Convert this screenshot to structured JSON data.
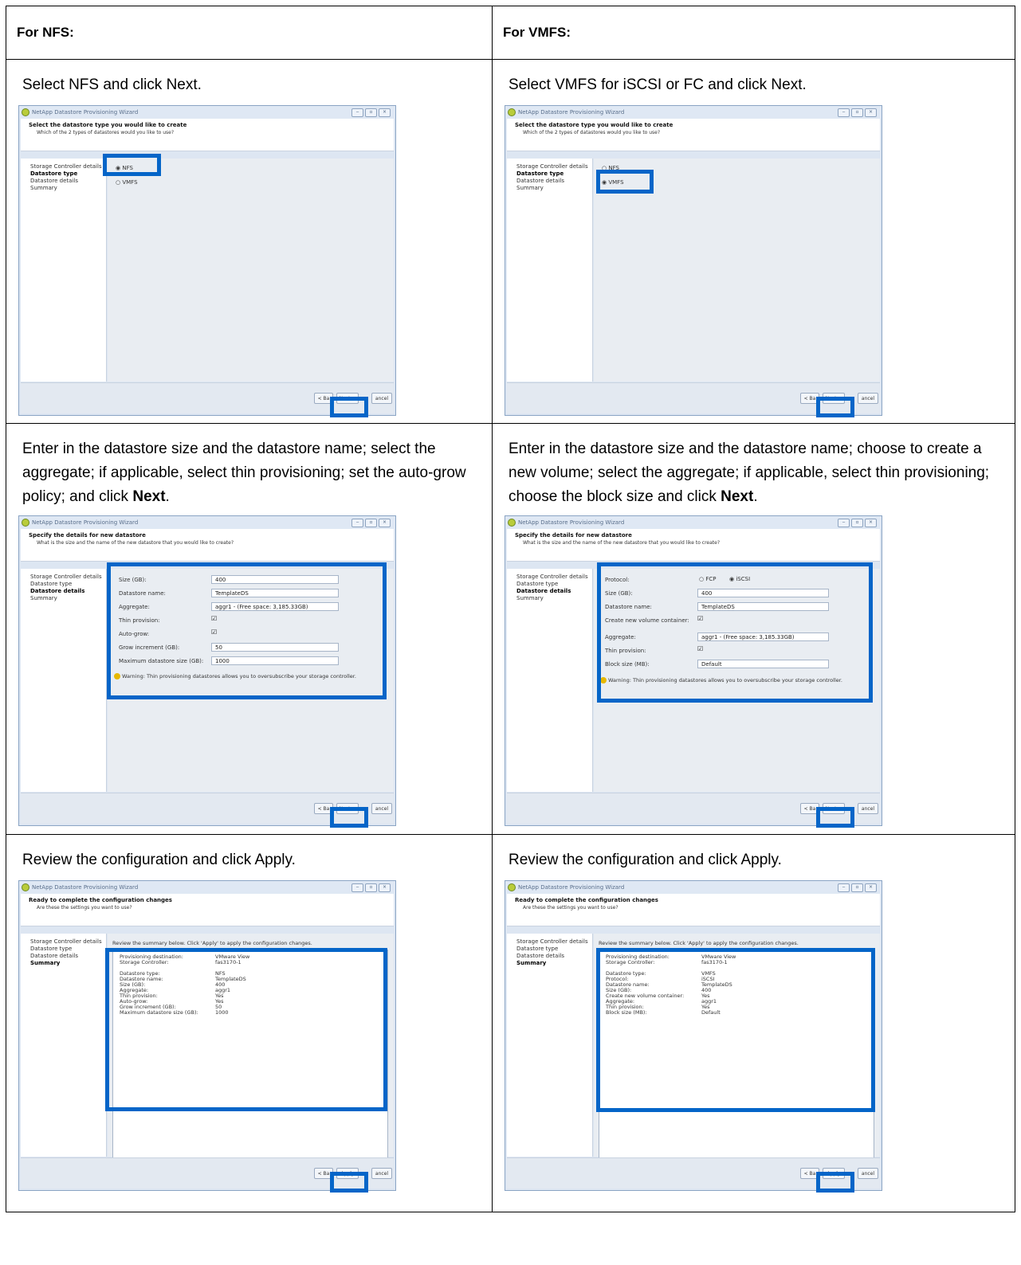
{
  "headers": {
    "nfs": "For NFS:",
    "vmfs": "For VMFS:"
  },
  "wizard_title": "NetApp Datastore Provisioning Wizard",
  "nav": [
    "Storage Controller details",
    "Datastore type",
    "Datastore details",
    "Summary"
  ],
  "buttons": {
    "back": "< Ba",
    "next": "Next >",
    "cancel": "ancel",
    "apply": "Apply"
  },
  "step1": {
    "banner_title": "Select the datastore type you would like to create",
    "banner_sub": "Which of the 2 types of datastores would you like to use?",
    "opt_nfs": "NFS",
    "opt_vmfs": "VMFS",
    "nfs_instr": "Select NFS and click Next.",
    "vmfs_instr": "Select VMFS for iSCSI or FC and click Next."
  },
  "step2": {
    "banner_title": "Specify the details for new datastore",
    "banner_sub": "What is the size and the name of the new datastore that you would like to create?",
    "nfs_instr_a": "Enter in the datastore size and the datastore name; select the aggregate; if applicable, select thin provisioning; set the auto-grow policy; and click ",
    "vmfs_instr_a": "Enter in the datastore size and the datastore name; choose to create a new volume; select the aggregate; if applicable, select thin provisioning; choose the block size and click ",
    "next_bold": "Next",
    "period": ".",
    "labels": {
      "protocol": "Protocol:",
      "size": "Size (GB):",
      "name": "Datastore name:",
      "new_volume": "Create new volume container:",
      "aggregate": "Aggregate:",
      "thin": "Thin provision:",
      "autogrow": "Auto-grow:",
      "grow_inc": "Grow increment (GB):",
      "max_size": "Maximum datastore size (GB):",
      "block_size": "Block size (MB):"
    },
    "values": {
      "size": "400",
      "name": "TemplateDS",
      "aggregate": "aggr1 - (Free space: 3,185.33GB)",
      "grow_inc": "50",
      "max_size": "1000",
      "block_size": "Default",
      "fcp": "FCP",
      "iscsi": "iSCSI",
      "check": "☑"
    },
    "warning": "Warning: Thin provisioning datastores allows you to oversubscribe your storage controller."
  },
  "step3": {
    "banner_title": "Ready to complete the configuration changes",
    "banner_sub": "Are these the settings you want to use?",
    "review_note": "Review the summary below. Click 'Apply' to apply the configuration changes.",
    "instr": "Review the configuration and click Apply.",
    "nfs_rows": [
      [
        "Provisioning destination:",
        "VMware View"
      ],
      [
        "Storage Controller:",
        "fas3170-1"
      ],
      [
        "",
        ""
      ],
      [
        "Datastore type:",
        "NFS"
      ],
      [
        "Datastore name:",
        "TemplateDS"
      ],
      [
        "Size (GB):",
        "400"
      ],
      [
        "Aggregate:",
        "aggr1"
      ],
      [
        "Thin provision:",
        "Yes"
      ],
      [
        "Auto-grow:",
        "Yes"
      ],
      [
        "Grow increment (GB):",
        "50"
      ],
      [
        "Maximum datastore size (GB):",
        "1000"
      ]
    ],
    "vmfs_rows": [
      [
        "Provisioning destination:",
        "VMware View"
      ],
      [
        "Storage Controller:",
        "fas3170-1"
      ],
      [
        "",
        ""
      ],
      [
        "Datastore type:",
        "VMFS"
      ],
      [
        "Protocol:",
        "iSCSI"
      ],
      [
        "Datastore name:",
        "TemplateDS"
      ],
      [
        "Size (GB):",
        "400"
      ],
      [
        "Create new volume container:",
        "Yes"
      ],
      [
        "Aggregate:",
        "aggr1"
      ],
      [
        "Thin provision:",
        "Yes"
      ],
      [
        "Block size (MB):",
        "Default"
      ]
    ]
  }
}
